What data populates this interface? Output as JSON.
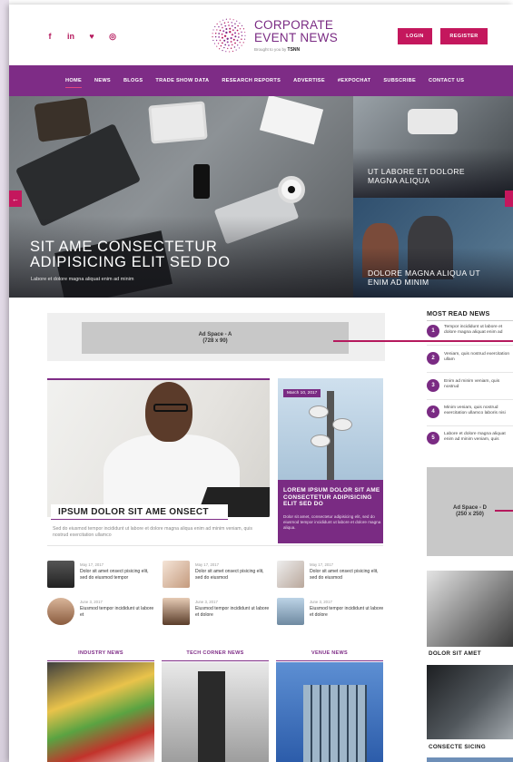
{
  "header": {
    "social_icons": [
      "facebook-icon",
      "linkedin-icon",
      "twitter-icon",
      "instagram-icon"
    ],
    "social_glyphs": [
      "f",
      "in",
      "♥",
      "◎"
    ],
    "logo_line1": "CORPORATE",
    "logo_line2": "EVENT NEWS",
    "logo_tagline": "Brought to you by",
    "logo_brand": "TSNN",
    "login_label": "LOGIN",
    "register_label": "REGISTER"
  },
  "nav": {
    "items": [
      "HOME",
      "NEWS",
      "BLOGS",
      "TRADE SHOW DATA",
      "RESEARCH REPORTS",
      "ADVERTISE",
      "#EXPOCHAT",
      "SUBSCRIBE",
      "CONTACT US"
    ],
    "active": "HOME"
  },
  "hero": {
    "main_title_line1": "SIT AME CONSECTETUR",
    "main_title_line2": "ADIPISICING ELIT SED DO",
    "main_subtitle": "Labore et dolore magna aliquat enim ad minim",
    "side1_line1": "UT LABORE ET DOLORE",
    "side1_line2": "MAGNA ALIQUA",
    "side2_line1": "DOLORE MAGNA ALIQUA UT",
    "side2_line2": "ENIM AD MINIM",
    "prev_glyph": "←"
  },
  "ad_a": {
    "line1": "Ad Space - A",
    "line2": "(728 x 90)"
  },
  "featured": {
    "title": "IPSUM DOLOR SIT AME ONSECT",
    "desc": "Sed do eiusmod tempor incididunt ut labore et dolore magna aliqua enim ad minim veniam, quis nostrud exercitation ullamco"
  },
  "purple_card": {
    "date": "March 10, 2017",
    "title": "LOREM IPSUM DOLOR SIT AME CONSECTETUR ADIPISICING ELIT SED DO",
    "desc": "Dolor sit amet, consectetur adipisicing elit, sed do eiusmod tempor incididunt ut labore et dolore magna aliqua."
  },
  "grid_items": [
    {
      "date": "May 17, 2017",
      "text": "Dolor sit amet onsect pisicing elit, sed do eiusmod tempor"
    },
    {
      "date": "May 17, 2017",
      "text": "Dolor sit amet onsect pisicing elit, sed do eiusmod"
    },
    {
      "date": "May 17, 2017",
      "text": "Dolor sit amet onsect pisicing elit, sed do eiusmod"
    },
    {
      "date": "June 3, 2017",
      "text": "Eiusmod tempor incididunt ut labore et"
    },
    {
      "date": "June 3, 2017",
      "text": "Eiusmod tempor incididunt ut labore et dolore"
    },
    {
      "date": "June 3, 2017",
      "text": "Eiusmod tempor incididunt ut labore et dolore"
    }
  ],
  "categories": [
    "INDUSTRY NEWS",
    "TECH CORNER NEWS",
    "VENUE NEWS"
  ],
  "sidebar": {
    "title": "MOST READ NEWS",
    "items": [
      {
        "num": "1",
        "text": "Tempor incididunt ut labore et dolore magna aliquat enim ad"
      },
      {
        "num": "2",
        "text": "Veniam, quis nostrud exercitation ullam"
      },
      {
        "num": "3",
        "text": "Enim ad minim veniam, quis nostrud"
      },
      {
        "num": "4",
        "text": "Minim veniam, quis nostrud exercitation ullamco laboris nisi"
      },
      {
        "num": "5",
        "text": "Labore et dolore magna aliquat enim ad minim veniam, quis"
      }
    ],
    "ad_d_line1": "Ad Space - D",
    "ad_d_line2": "(250 x 250)",
    "caption1": "DOLOR SIT AMET",
    "caption2": "CONSECTE SICING"
  },
  "colors": {
    "brand_purple": "#7e2c86",
    "accent_pink": "#c4175d"
  }
}
